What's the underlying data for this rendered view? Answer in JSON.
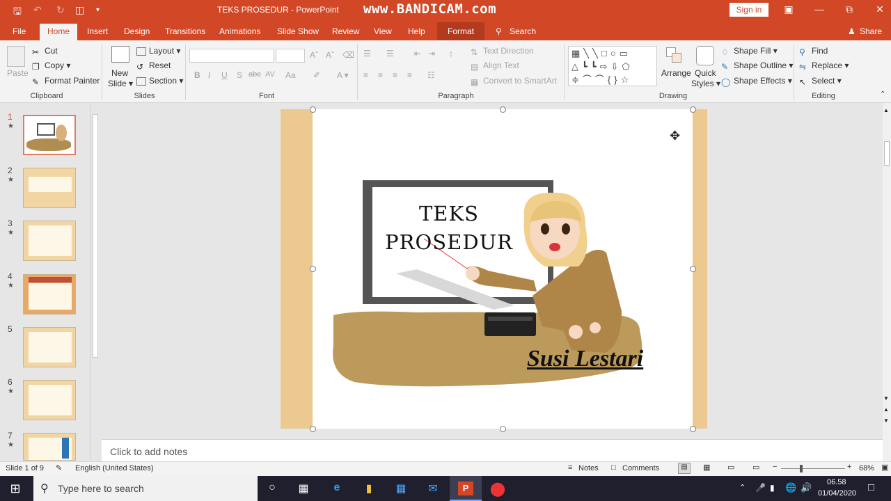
{
  "window": {
    "title": "TEKS PROSEDUR  -  PowerPoint",
    "watermark": "www.BANDICAM.com",
    "sign_in": "Sign in"
  },
  "tabs": {
    "file": "File",
    "home": "Home",
    "insert": "Insert",
    "design": "Design",
    "transitions": "Transitions",
    "animations": "Animations",
    "slide_show": "Slide Show",
    "review": "Review",
    "view": "View",
    "help": "Help",
    "format": "Format",
    "search": "Search",
    "share": "Share"
  },
  "ribbon": {
    "clipboard": {
      "paste": "Paste",
      "cut": "Cut",
      "copy": "Copy",
      "format_painter": "Format Painter",
      "label": "Clipboard"
    },
    "slides": {
      "new_slide": "New",
      "new_slide2": "Slide",
      "layout": "Layout",
      "reset": "Reset",
      "section": "Section",
      "label": "Slides"
    },
    "font": {
      "label": "Font",
      "bold": "B",
      "italic": "I",
      "underline": "U",
      "shadow": "S",
      "strike": "abc",
      "spacing": "AV",
      "case": "Aa"
    },
    "paragraph": {
      "label": "Paragraph",
      "text_direction": "Text Direction",
      "align_text": "Align Text",
      "smartart": "Convert to SmartArt"
    },
    "drawing": {
      "label": "Drawing",
      "arrange": "Arrange",
      "quick_styles": "Quick",
      "quick_styles2": "Styles",
      "shape_fill": "Shape Fill",
      "shape_outline": "Shape Outline",
      "shape_effects": "Shape Effects"
    },
    "editing": {
      "label": "Editing",
      "find": "Find",
      "replace": "Replace",
      "select": "Select"
    }
  },
  "slides_panel": {
    "numbers": [
      "1",
      "2",
      "3",
      "4",
      "5",
      "6",
      "7"
    ]
  },
  "slide": {
    "title_line1": "TEKS",
    "title_line2": "PROSEDUR",
    "author": "Susi Lestari"
  },
  "notes": {
    "placeholder": "Click to add notes"
  },
  "status": {
    "slide_info": "Slide 1 of 9",
    "language": "English (United States)",
    "notes": "Notes",
    "comments": "Comments",
    "zoom": "68%"
  },
  "taskbar": {
    "search_placeholder": "Type here to search",
    "time": "06.58",
    "date": "01/04/2020"
  },
  "colors": {
    "accent": "#d24726",
    "slide_bg": "#ecc990"
  }
}
